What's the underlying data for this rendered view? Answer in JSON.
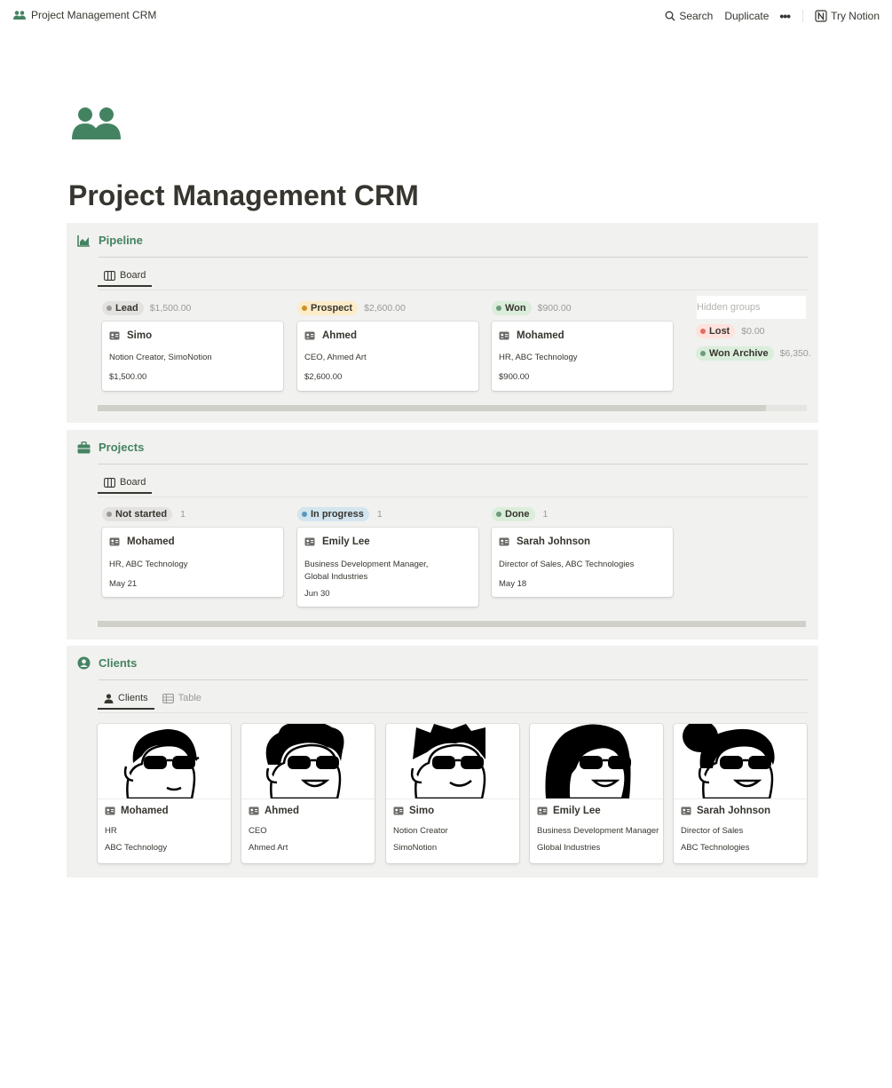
{
  "topbar": {
    "page_name": "Project Management CRM",
    "search_label": "Search",
    "duplicate_label": "Duplicate",
    "more_label": "•••",
    "try_label": "Try Notion"
  },
  "page": {
    "title": "Project Management CRM",
    "accent_color": "#448361"
  },
  "pipeline": {
    "title": "Pipeline",
    "view_tab": "Board",
    "groups": [
      {
        "label": "Lead",
        "amount": "$1,500.00",
        "color": "#e3e2e0",
        "dot": "#9b9a97"
      },
      {
        "label": "Prospect",
        "amount": "$2,600.00",
        "color": "#fdecc8",
        "dot": "#cb912f"
      },
      {
        "label": "Won",
        "amount": "$900.00",
        "color": "#dbeddb",
        "dot": "#6c9b7d"
      }
    ],
    "cards": [
      {
        "name": "Simo",
        "role": "Notion Creator, SimoNotion",
        "value": "$1,500.00"
      },
      {
        "name": "Ahmed",
        "role": "CEO, Ahmed Art",
        "value": "$2,600.00"
      },
      {
        "name": "Mohamed",
        "role": "HR, ABC Technology",
        "value": "$900.00"
      }
    ],
    "hidden_groups_label": "Hidden groups",
    "hidden_groups": [
      {
        "label": "Lost",
        "amount": "$0.00",
        "color": "#ffe2dd",
        "dot": "#e16f64"
      },
      {
        "label": "Won Archive",
        "amount": "$6,350.",
        "color": "#dbeddb",
        "dot": "#6c9b7d"
      }
    ]
  },
  "projects": {
    "title": "Projects",
    "view_tab": "Board",
    "groups": [
      {
        "label": "Not started",
        "count": "1",
        "color": "#e3e2e0",
        "dot": "#9b9a97"
      },
      {
        "label": "In progress",
        "count": "1",
        "color": "#d3e5ef",
        "dot": "#5b97bd"
      },
      {
        "label": "Done",
        "count": "1",
        "color": "#dbeddb",
        "dot": "#6c9b7d"
      }
    ],
    "cards": [
      {
        "name": "Mohamed",
        "line1": "HR, ABC Technology",
        "line2": "",
        "date": "May 21"
      },
      {
        "name": "Emily Lee",
        "line1": "Business Development Manager,",
        "line2": "Global Industries",
        "date": "Jun 30"
      },
      {
        "name": "Sarah Johnson",
        "line1": "Director of Sales, ABC Technologies",
        "line2": "",
        "date": "May 18"
      }
    ]
  },
  "clients": {
    "title": "Clients",
    "tabs": [
      "Clients",
      "Table"
    ],
    "cards": [
      {
        "name": "Mohamed",
        "title": "HR",
        "company": "ABC Technology",
        "hair": "short"
      },
      {
        "name": "Ahmed",
        "title": "CEO",
        "company": "Ahmed Art",
        "hair": "curly"
      },
      {
        "name": "Simo",
        "title": "Notion Creator",
        "company": "SimoNotion",
        "hair": "spiky"
      },
      {
        "name": "Emily Lee",
        "title": "Business Development Manager",
        "company": "Global Industries",
        "hair": "long"
      },
      {
        "name": "Sarah Johnson",
        "title": "Director of Sales",
        "company": "ABC Technologies",
        "hair": "bun"
      }
    ]
  }
}
